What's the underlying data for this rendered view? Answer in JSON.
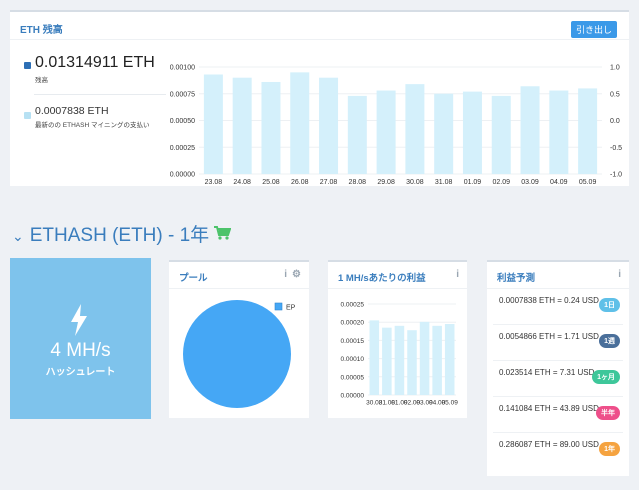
{
  "balance": {
    "title": "ETH 残高",
    "withdraw_label": "引き出し",
    "main_value": "0.01314911 ETH",
    "main_label": "残高",
    "sub_value": "0.0007838 ETH",
    "sub_label": "最新のの ETHASH マイニングの支払い"
  },
  "section": {
    "title": "ETHASH (ETH) - 1年"
  },
  "hashrate": {
    "value": "4 MH/s",
    "label": "ハッシュレート"
  },
  "pool": {
    "title": "プール",
    "info_label": "i",
    "legend": "EP"
  },
  "profit": {
    "title": "1 MH/sあたりの利益",
    "info_label": "i"
  },
  "estimate": {
    "title": "利益予測",
    "info_label": "i",
    "rows": [
      {
        "text": "0.0007838 ETH = 0.24 USD",
        "badge": "1日",
        "color": "#5fc0e8"
      },
      {
        "text": "0.0054866 ETH = 1.71 USD",
        "badge": "1週",
        "color": "#4a6f9a"
      },
      {
        "text": "0.023514 ETH = 7.31 USD",
        "badge": "1ヶ月",
        "color": "#3ec79a"
      },
      {
        "text": "0.141084 ETH = 43.89 USD",
        "badge": "半年",
        "color": "#ee4f8a"
      },
      {
        "text": "0.286087 ETH = 89.00 USD",
        "badge": "1年",
        "color": "#f5a340"
      }
    ]
  },
  "chart_data": [
    {
      "type": "bar",
      "categories": [
        "23.08",
        "24.08",
        "25.08",
        "26.08",
        "27.08",
        "28.08",
        "29.08",
        "30.08",
        "31.08",
        "01.09",
        "02.09",
        "03.09",
        "04.09",
        "05.09"
      ],
      "values": [
        0.00093,
        0.0009,
        0.00086,
        0.00095,
        0.0009,
        0.00073,
        0.00078,
        0.00084,
        0.00075,
        0.00077,
        0.00073,
        0.00082,
        0.00078,
        0.0008
      ],
      "y_ticks": [
        "0.00000",
        "0.00025",
        "0.00050",
        "0.00075",
        "0.00100"
      ],
      "y2_ticks": [
        "-1.0",
        "-0.5",
        "0.0",
        "0.5",
        "1.0"
      ],
      "ylim": [
        0,
        0.001
      ],
      "y2lim": [
        -1,
        1
      ],
      "bar_color": "#d4f0fb"
    },
    {
      "type": "pie",
      "legend": [
        "EP"
      ],
      "values": [
        100
      ],
      "color": "#45a7f5"
    },
    {
      "type": "bar",
      "categories": [
        "30.08",
        "31.08",
        "01.09",
        "02.09",
        "03.09",
        "04.09",
        "05.09"
      ],
      "values": [
        0.000205,
        0.000185,
        0.00019,
        0.000178,
        0.000201,
        0.00019,
        0.000195
      ],
      "y_ticks": [
        "0.00000",
        "0.00005",
        "0.00010",
        "0.00015",
        "0.00020",
        "0.00025"
      ],
      "ylim": [
        0,
        0.00025
      ],
      "bar_color": "#d4f0fb"
    }
  ]
}
